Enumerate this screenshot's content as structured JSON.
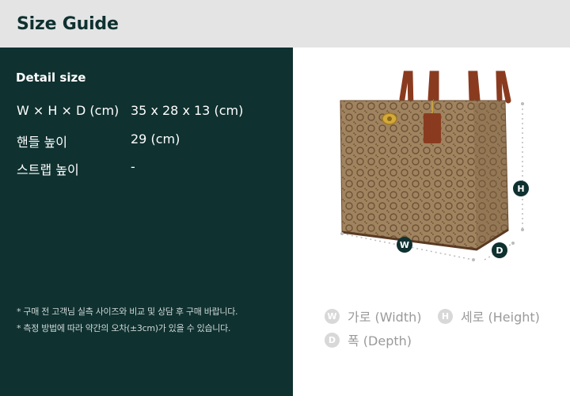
{
  "header": {
    "title": "Size Guide"
  },
  "detail": {
    "title": "Detail size",
    "specs": [
      {
        "label": "W × H × D (cm)",
        "value": "35 x 28 x 13 (cm)"
      },
      {
        "label": "핸들 높이",
        "value": "29 (cm)"
      },
      {
        "label": "스트랩 높이",
        "value": "-"
      }
    ],
    "notes": [
      "* 구매 전 고객님 실측 사이즈와 비교 및 상담 후 구매 바랍니다.",
      "* 측정 방법에 따라 약간의 오차(±3cm)가 있을 수 있습니다."
    ]
  },
  "diagram": {
    "markers": {
      "w": "W",
      "h": "H",
      "d": "D"
    },
    "colors": {
      "marker": "#0f3130",
      "bag_canvas": "#a0835f",
      "leather": "#8a3b1f",
      "hardware": "#d4a93a"
    }
  },
  "legend": [
    {
      "badge": "W",
      "label": "가로 (Width)"
    },
    {
      "badge": "H",
      "label": "세로 (Height)"
    },
    {
      "badge": "D",
      "label": "폭 (Depth)"
    }
  ],
  "colors": {
    "header_bg": "#e4e4e4",
    "panel_bg": "#0f3130",
    "accent": "#0f3130"
  }
}
